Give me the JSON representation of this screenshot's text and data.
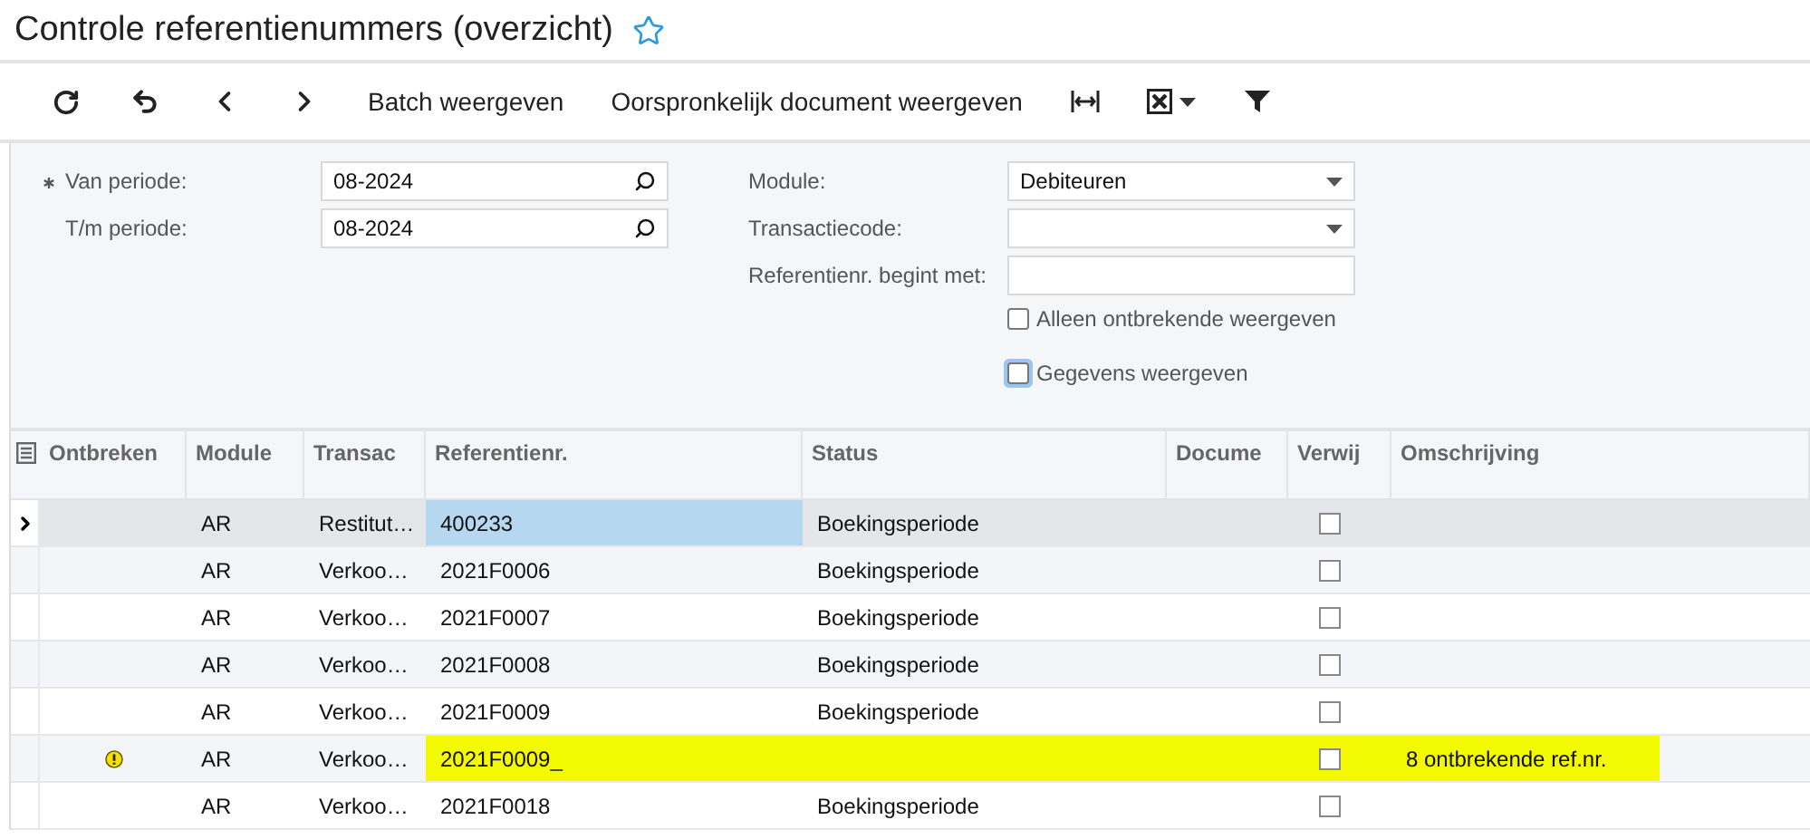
{
  "title": "Controle referentienummers (overzicht)",
  "favorite": false,
  "toolbar": [
    {
      "kind": "refresh"
    },
    {
      "kind": "undo"
    },
    {
      "kind": "prev"
    },
    {
      "kind": "next"
    },
    {
      "kind": "text",
      "label": "Batch weergeven"
    },
    {
      "kind": "text",
      "label": "Oorspronkelijk document weergeven"
    },
    {
      "kind": "fit"
    },
    {
      "kind": "excel"
    },
    {
      "kind": "filter"
    }
  ],
  "filters": {
    "left": [
      {
        "label": "Van periode:",
        "required": true,
        "kind": "lookup",
        "value": "08-2024"
      },
      {
        "label": "T/m periode:",
        "required": false,
        "kind": "lookup",
        "value": "08-2024"
      }
    ],
    "right": [
      {
        "label": "Module:",
        "kind": "select",
        "value": "Debiteuren"
      },
      {
        "label": "Transactiecode:",
        "kind": "select"
      },
      {
        "label": "Referentienr. begint met:",
        "kind": "text"
      }
    ],
    "checkboxes": [
      {
        "label": "Alleen ontbrekende weergeven",
        "checked": false,
        "focused": false
      },
      {
        "label": "Gegevens weergeven",
        "checked": false,
        "focused": true
      }
    ]
  },
  "table": {
    "columns": [
      "Ontbreken",
      "Module",
      "Transac",
      "Referentienr.",
      "Status",
      "Docume",
      "Verwij",
      "Omschrijving"
    ],
    "rows": [
      {
        "selected": true,
        "missing": false,
        "highlighted": false,
        "module": "AR",
        "transaction": "Restitut…",
        "reference": "400233",
        "status": "Boekingsperiode",
        "removed": false
      },
      {
        "selected": false,
        "missing": false,
        "highlighted": false,
        "module": "AR",
        "transaction": "Verkoo…",
        "reference": "2021F0006",
        "status": "Boekingsperiode",
        "removed": false
      },
      {
        "selected": false,
        "missing": false,
        "highlighted": false,
        "module": "AR",
        "transaction": "Verkoo…",
        "reference": "2021F0007",
        "status": "Boekingsperiode",
        "removed": false
      },
      {
        "selected": false,
        "missing": false,
        "highlighted": false,
        "module": "AR",
        "transaction": "Verkoo…",
        "reference": "2021F0008",
        "status": "Boekingsperiode",
        "removed": false
      },
      {
        "selected": false,
        "missing": false,
        "highlighted": false,
        "module": "AR",
        "transaction": "Verkoo…",
        "reference": "2021F0009",
        "status": "Boekingsperiode",
        "removed": false
      },
      {
        "selected": false,
        "missing": true,
        "highlighted": true,
        "module": "AR",
        "transaction": "Verkoo…",
        "reference": "2021F0009_",
        "removed": false,
        "description": "8 ontbrekende ref.nr."
      },
      {
        "selected": false,
        "missing": false,
        "highlighted": false,
        "module": "AR",
        "transaction": "Verkoo…",
        "reference": "2021F0018",
        "status": "Boekingsperiode",
        "removed": false
      }
    ]
  }
}
